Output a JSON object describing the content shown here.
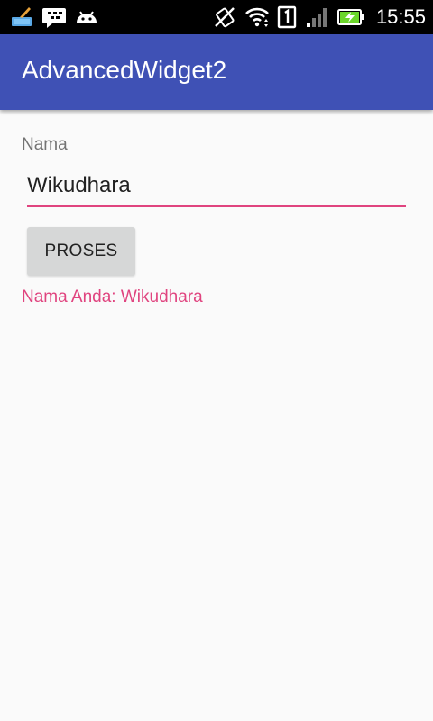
{
  "status_bar": {
    "time": "15:55",
    "icons": [
      "broom-cleaner-icon",
      "bbm-icon",
      "android-icon",
      "no-vibrate-icon",
      "wifi-icon",
      "sim-1-icon",
      "signal-icon",
      "battery-charging-icon"
    ]
  },
  "app_bar": {
    "title": "AdvancedWidget2",
    "color": "#3f51b5"
  },
  "form": {
    "label": "Nama",
    "input_value": "Wikudhara",
    "accent_color": "#e0447f",
    "button_label": "PROSES"
  },
  "result": {
    "text": "Nama Anda: Wikudhara"
  }
}
